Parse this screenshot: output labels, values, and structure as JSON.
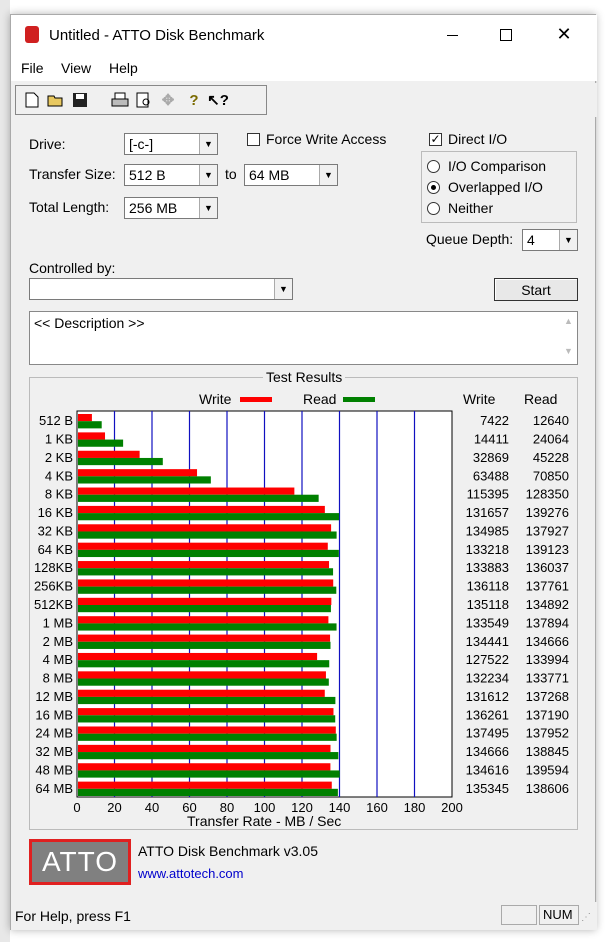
{
  "window": {
    "title": "Untitled - ATTO Disk Benchmark"
  },
  "menu": [
    "File",
    "View",
    "Help"
  ],
  "toolbar_icons": [
    "new-icon",
    "open-icon",
    "save-icon",
    "print-icon",
    "print-preview-icon",
    "move-icon",
    "help-icon",
    "context-help-icon"
  ],
  "controls": {
    "drive_label": "Drive:",
    "drive_value": "[-c-]",
    "force_write_label": "Force Write Access",
    "direct_io_label": "Direct I/O",
    "transfer_size_label": "Transfer Size:",
    "transfer_from": "512 B",
    "to_label": "to",
    "transfer_to": "64 MB",
    "total_length_label": "Total Length:",
    "total_length": "256 MB",
    "io_comparison": "I/O Comparison",
    "overlapped_io": "Overlapped I/O",
    "neither": "Neither",
    "queue_depth_label": "Queue Depth:",
    "queue_depth": "4",
    "controlled_by_label": "Controlled by:",
    "start_button": "Start",
    "description": "<< Description >>"
  },
  "results": {
    "title": "Test Results",
    "legend_write": "Write",
    "legend_read": "Read",
    "col_write": "Write",
    "col_read": "Read"
  },
  "chart_data": {
    "type": "bar",
    "orientation": "horizontal",
    "xlabel": "Transfer Rate - MB / Sec",
    "xlim": [
      0,
      200
    ],
    "xticks": [
      "0",
      "20",
      "40",
      "60",
      "80",
      "100",
      "120",
      "140",
      "160",
      "180",
      "200"
    ],
    "categories": [
      "512 B",
      "1 KB",
      "2 KB",
      "4 KB",
      "8 KB",
      "16 KB",
      "32 KB",
      "64 KB",
      "128KB",
      "256KB",
      "512KB",
      "1 MB",
      "2 MB",
      "4 MB",
      "8 MB",
      "12 MB",
      "16 MB",
      "24 MB",
      "32 MB",
      "48 MB",
      "64 MB"
    ],
    "series": [
      {
        "name": "Write",
        "color": "#ff0000",
        "values": [
          7422,
          14411,
          32869,
          63488,
          115395,
          131657,
          134985,
          133218,
          133883,
          136118,
          135118,
          133549,
          134441,
          127522,
          132234,
          131612,
          136261,
          137495,
          134666,
          134616,
          135345
        ]
      },
      {
        "name": "Read",
        "color": "#008000",
        "values": [
          12640,
          24064,
          45228,
          70850,
          128350,
          139276,
          137927,
          139123,
          136037,
          137761,
          134892,
          137894,
          134666,
          133994,
          133771,
          137268,
          137190,
          137952,
          138845,
          139594,
          138606
        ]
      }
    ],
    "write_labels": [
      "7422",
      "14411",
      "32869",
      "63488",
      "115395",
      "131657",
      "134985",
      "133218",
      "133883",
      "136118",
      "135118",
      "133549",
      "134441",
      "127522",
      "132234",
      "131612",
      "136261",
      "137495",
      "134666",
      "134616",
      "135345"
    ],
    "read_labels": [
      "12640",
      "24064",
      "45228",
      "70850",
      "128350",
      "139276",
      "137927",
      "139123",
      "136037",
      "137761",
      "134892",
      "137894",
      "134666",
      "133994",
      "133771",
      "137268",
      "137190",
      "137952",
      "138845",
      "139594",
      "138606"
    ]
  },
  "footer": {
    "logo_text": "ATTO",
    "version": "ATTO Disk Benchmark v3.05",
    "url": "www.attotech.com"
  },
  "status": {
    "help": "For Help, press F1",
    "num": "NUM"
  }
}
